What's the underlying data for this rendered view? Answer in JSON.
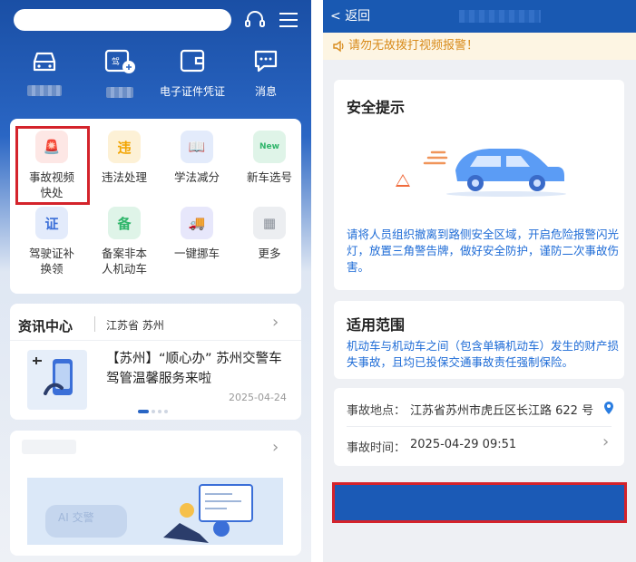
{
  "left": {
    "top_items": [
      {
        "label": ""
      },
      {
        "label": ""
      },
      {
        "label": "电子证件凭证"
      },
      {
        "label": "消息"
      }
    ],
    "services": [
      {
        "label": "事故视频\n快处",
        "color": "#f0625a",
        "bg": "#fde7e5"
      },
      {
        "label": "违法处理",
        "color": "#f2a400",
        "bg": "#fdf1d6"
      },
      {
        "label": "学法减分",
        "color": "#3b6fd8",
        "bg": "#e3ebfb"
      },
      {
        "label": "新车选号",
        "color": "#2fb56a",
        "bg": "#dff4e8"
      },
      {
        "label": "驾驶证补\n换领",
        "color": "#3b6fd8",
        "bg": "#e3ebfb"
      },
      {
        "label": "备案非本\n人机动车",
        "color": "#2fb56a",
        "bg": "#dff4e8"
      },
      {
        "label": "一键挪车",
        "color": "#5b5fd6",
        "bg": "#e7e7fb"
      },
      {
        "label": "更多",
        "color": "#8a9099",
        "bg": "#eceef1"
      }
    ],
    "news": {
      "title": "资讯中心",
      "location": "江苏省 苏州",
      "headline": "【苏州】“顺心办” 苏州交警车驾管温馨服务来啦",
      "date": "2025-04-24"
    }
  },
  "right": {
    "back_label": "返回",
    "warning": "请勿无故拨打视频报警！",
    "safety": {
      "title": "安全提示",
      "text": "请将人员组织撤离到路侧安全区域，开启危险报警闪光灯，放置三角警告牌，做好安全防护，谨防二次事故伤害。"
    },
    "scope": {
      "title": "适用范围",
      "text": "机动车与机动车之间（包含单辆机动车）发生的财产损失事故，且均已投保交通事故责任强制保险。"
    },
    "location": {
      "label": "事故地点：",
      "value": "江苏省苏州市虎丘区长江路 622 号"
    },
    "time": {
      "label": "事故时间：",
      "value": "2025-04-29 09:51"
    }
  }
}
